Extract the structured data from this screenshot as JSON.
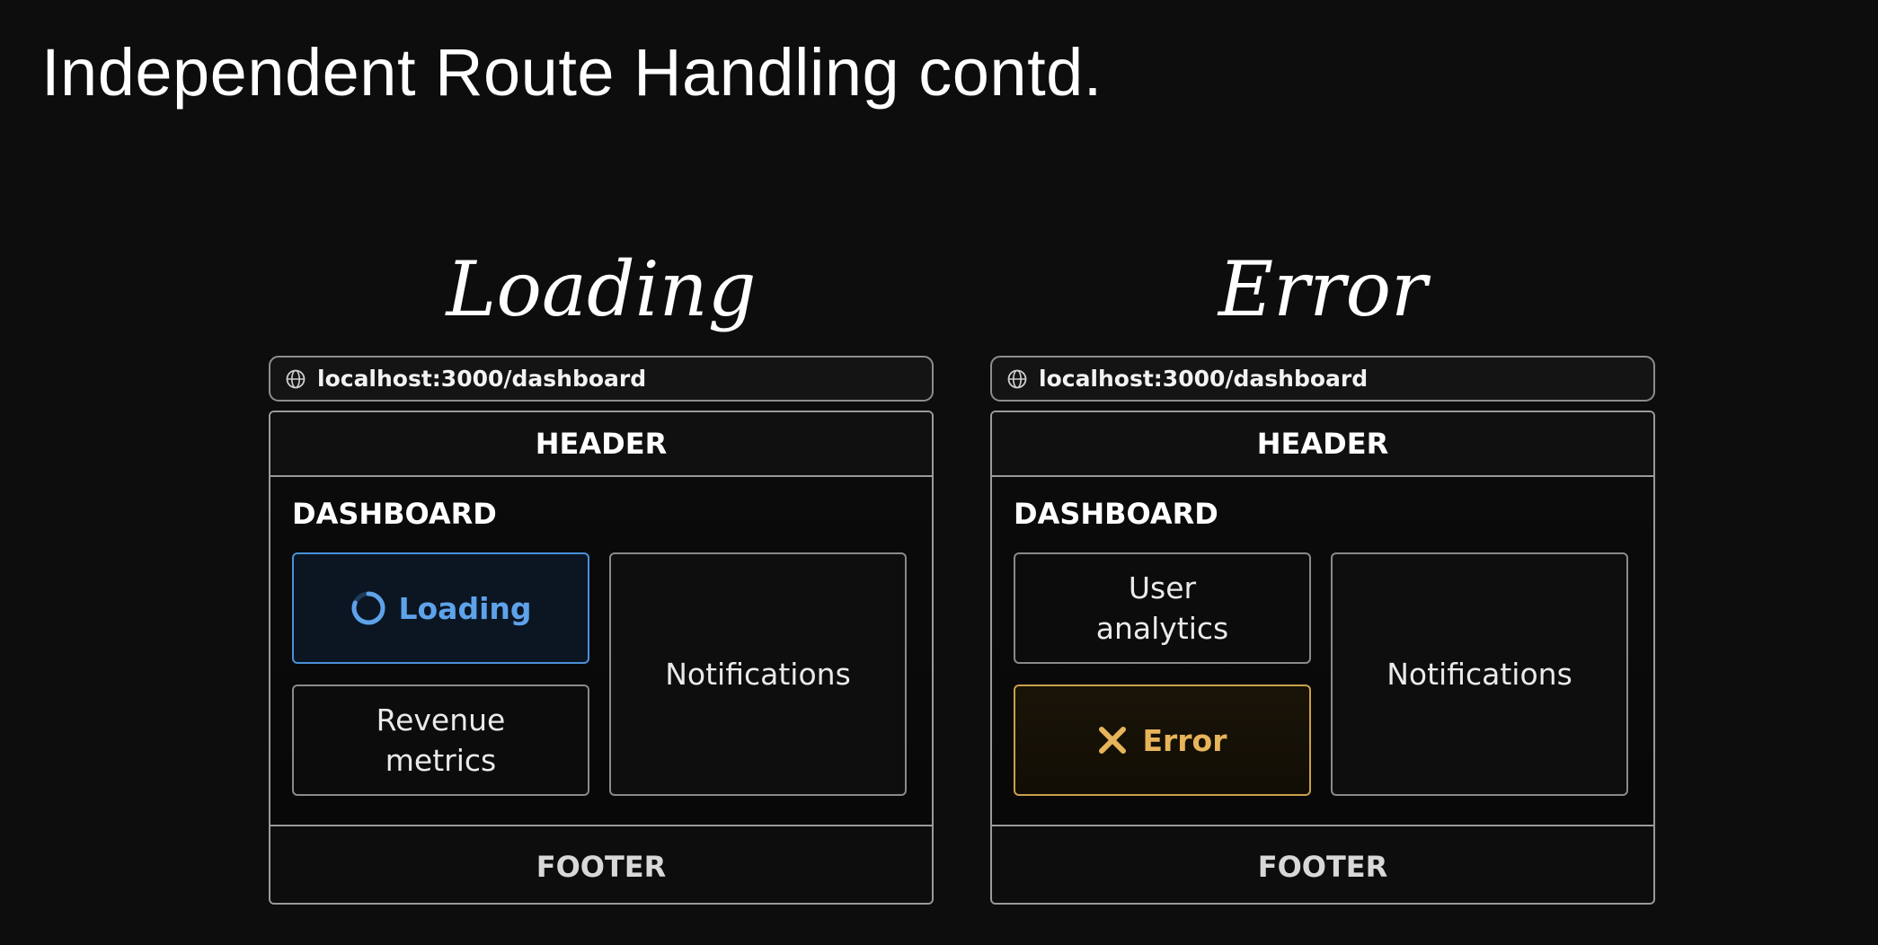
{
  "slide": {
    "title": "Independent Route Handling contd."
  },
  "panels": {
    "loading": {
      "heading": "Loading",
      "url": "localhost:3000/dashboard",
      "header_label": "HEADER",
      "dashboard_label": "DASHBOARD",
      "slot_a": {
        "state": "loading",
        "label": "Loading",
        "icon": "spinner-icon",
        "color": "#4a90d9"
      },
      "slot_b": {
        "label_line1": "Revenue",
        "label_line2": "metrics"
      },
      "notifications_label": "Notifications",
      "footer_label": "FOOTER"
    },
    "error": {
      "heading": "Error",
      "url": "localhost:3000/dashboard",
      "header_label": "HEADER",
      "dashboard_label": "DASHBOARD",
      "slot_a": {
        "label_line1": "User",
        "label_line2": "analytics"
      },
      "slot_b": {
        "state": "error",
        "label": "Error",
        "icon": "x-icon",
        "color": "#c9a04a"
      },
      "notifications_label": "Notifications",
      "footer_label": "FOOTER"
    }
  }
}
